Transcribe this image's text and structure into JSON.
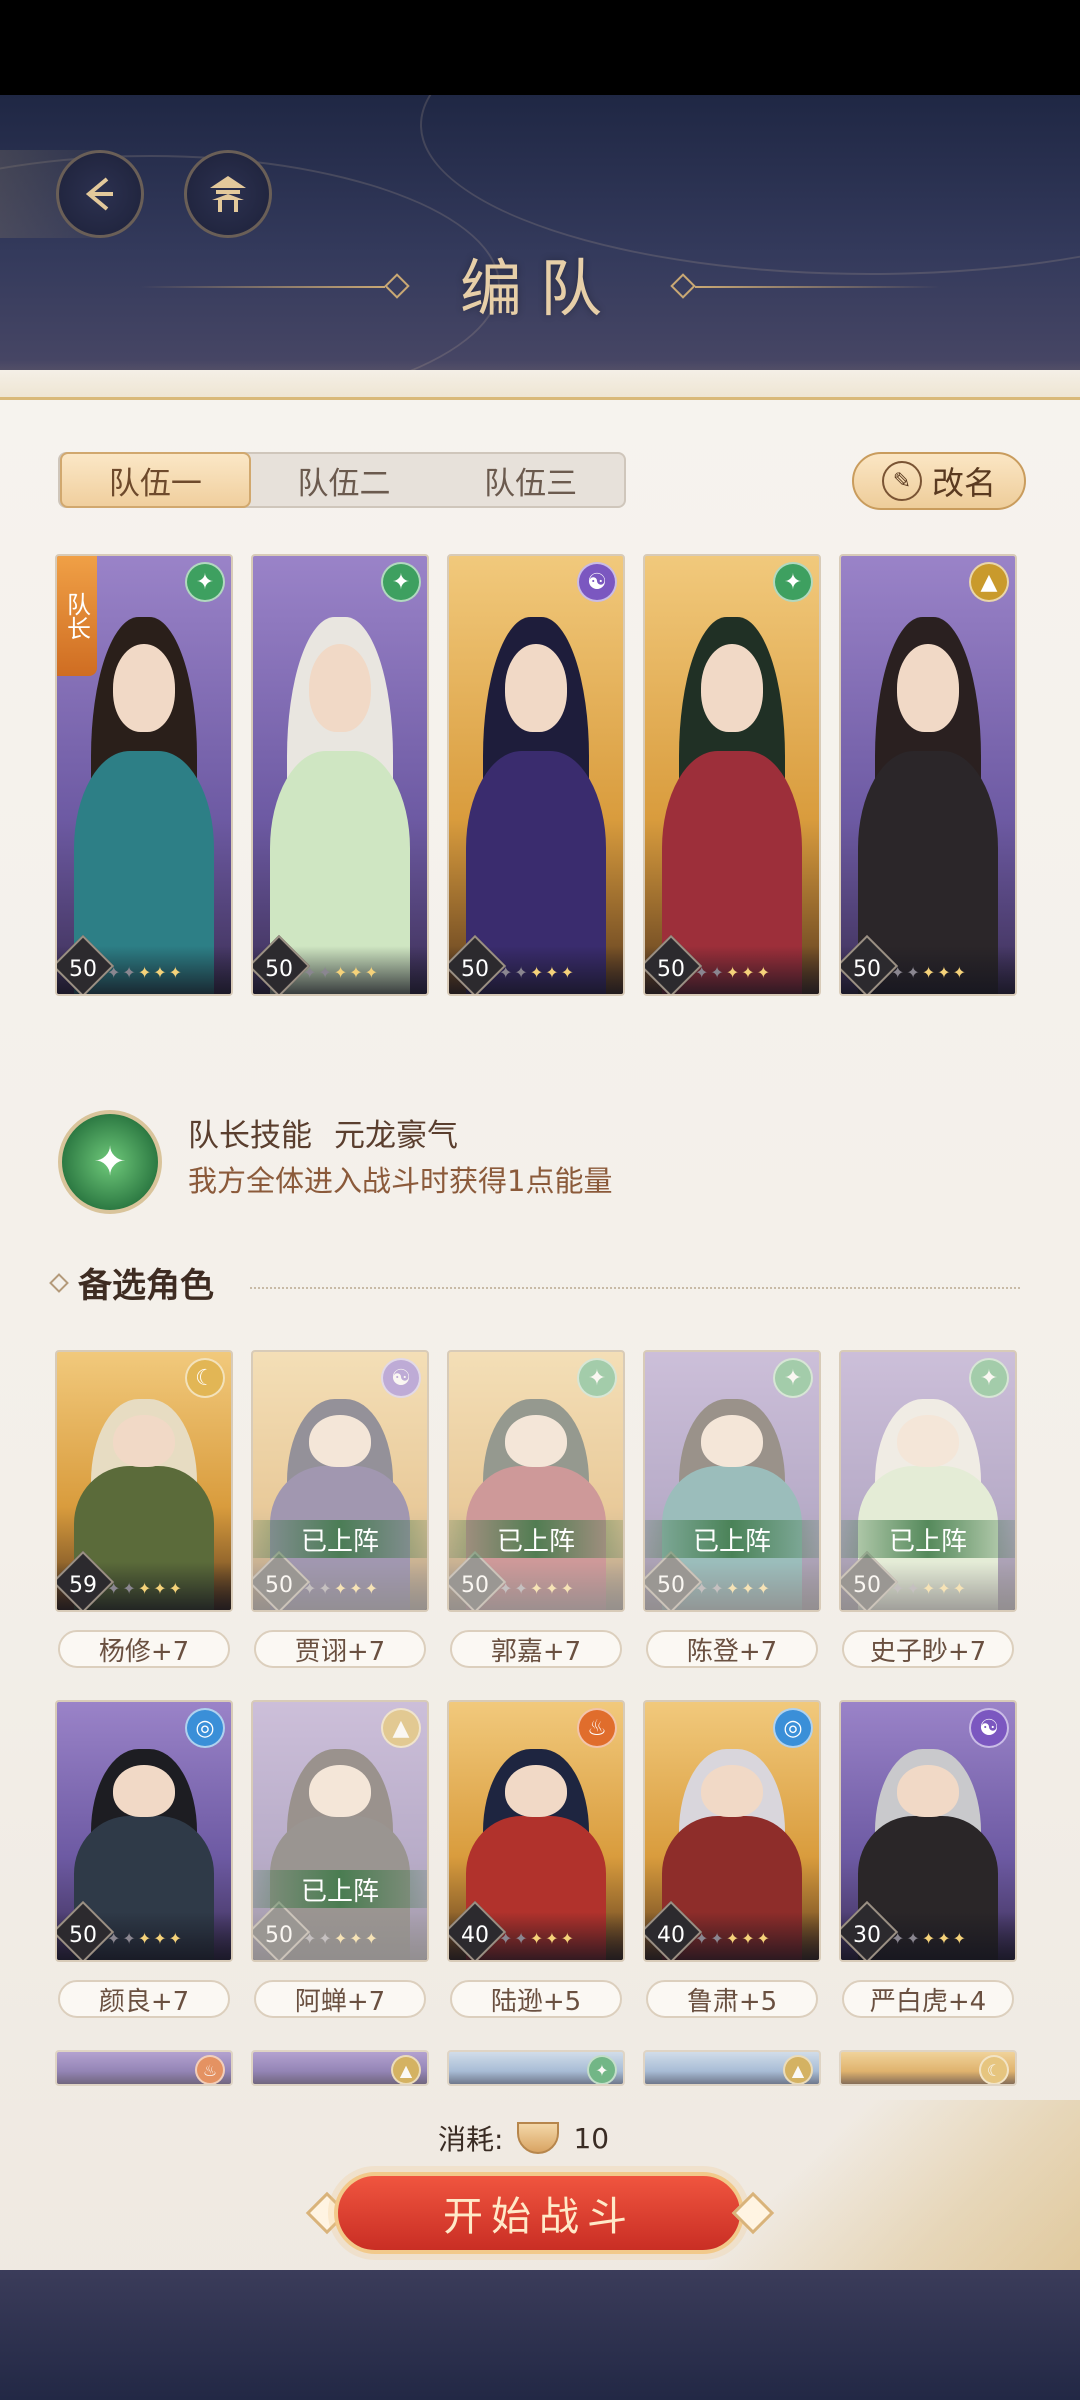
{
  "header": {
    "title": "编队"
  },
  "tabs": [
    {
      "label": "队伍一",
      "active": true
    },
    {
      "label": "队伍二",
      "active": false
    },
    {
      "label": "队伍三",
      "active": false
    }
  ],
  "rename_label": "改名",
  "captain_label": "队长",
  "team": [
    {
      "level": "50",
      "element": "green",
      "bg": "purple",
      "hair": "#2a1f1a",
      "robe": "#2d7f86"
    },
    {
      "level": "50",
      "element": "green",
      "bg": "purple",
      "hair": "#e9e6e0",
      "robe": "#cfe6c2"
    },
    {
      "level": "50",
      "element": "purple",
      "bg": "gold",
      "hair": "#1e1d3b",
      "robe": "#3a2c6e"
    },
    {
      "level": "50",
      "element": "green",
      "bg": "gold",
      "hair": "#203025",
      "robe": "#9d2f3a"
    },
    {
      "level": "50",
      "element": "gold",
      "bg": "purple",
      "hair": "#2a2020",
      "robe": "#2b2629"
    }
  ],
  "skill": {
    "label": "队长技能",
    "name": "元龙豪气",
    "description": "我方全体进入战斗时获得1点能量"
  },
  "candidates_title": "备选角色",
  "deployed_label": "已上阵",
  "candidates_row1": [
    {
      "name": "杨修+7",
      "level": "59",
      "element": "moon",
      "bg": "gold",
      "deployed": false,
      "hair": "#e7dcc2",
      "robe": "#5b6b3a"
    },
    {
      "name": "贾诩+7",
      "level": "50",
      "element": "purple",
      "bg": "gold",
      "deployed": true,
      "hair": "#1e1d3b",
      "robe": "#3a2c6e"
    },
    {
      "name": "郭嘉+7",
      "level": "50",
      "element": "green",
      "bg": "gold",
      "deployed": true,
      "hair": "#203025",
      "robe": "#9d2f3a"
    },
    {
      "name": "陈登+7",
      "level": "50",
      "element": "green",
      "bg": "purple",
      "deployed": true,
      "hair": "#2a1f1a",
      "robe": "#2d7f86"
    },
    {
      "name": "史子眇+7",
      "level": "50",
      "element": "green",
      "bg": "purple",
      "deployed": true,
      "hair": "#e9e6e0",
      "robe": "#cfe6c2"
    }
  ],
  "candidates_row2": [
    {
      "name": "颜良+7",
      "level": "50",
      "element": "blue",
      "bg": "purple",
      "deployed": false,
      "hair": "#1d1d22",
      "robe": "#2f3a48"
    },
    {
      "name": "阿蝉+7",
      "level": "50",
      "element": "gold",
      "bg": "purple",
      "deployed": true,
      "hair": "#2a2020",
      "robe": "#2b2629"
    },
    {
      "name": "陆逊+5",
      "level": "40",
      "element": "fire",
      "bg": "gold",
      "deployed": false,
      "hair": "#1e2540",
      "robe": "#b1322c"
    },
    {
      "name": "鲁肃+5",
      "level": "40",
      "element": "blue",
      "bg": "gold",
      "deployed": false,
      "hair": "#d9d6dc",
      "robe": "#8e2d2a"
    },
    {
      "name": "严白虎+4",
      "level": "30",
      "element": "purple",
      "bg": "purple",
      "deployed": false,
      "hair": "#c9c9cc",
      "robe": "#2a2628"
    }
  ],
  "cost": {
    "label": "消耗:",
    "value": "10"
  },
  "start_label": "开始战斗"
}
